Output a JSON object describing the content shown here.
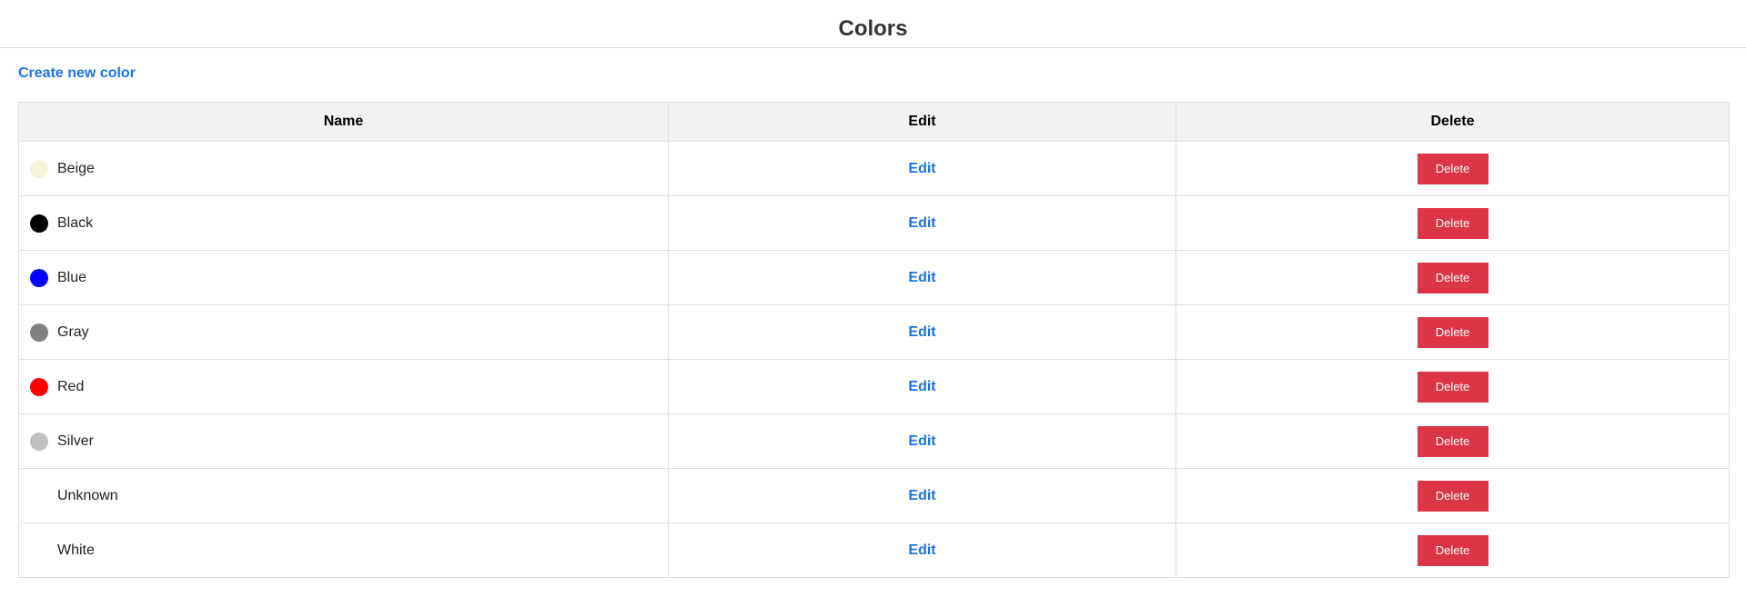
{
  "page": {
    "title": "Colors",
    "create_link": "Create new color"
  },
  "table": {
    "headers": [
      "Name",
      "Edit",
      "Delete"
    ],
    "rows": [
      {
        "name": "Beige",
        "swatch": "#f5f5dc",
        "edit": "Edit",
        "delete": "Delete"
      },
      {
        "name": "Black",
        "swatch": "#000000",
        "edit": "Edit",
        "delete": "Delete"
      },
      {
        "name": "Blue",
        "swatch": "#0000ff",
        "edit": "Edit",
        "delete": "Delete"
      },
      {
        "name": "Gray",
        "swatch": "#808080",
        "edit": "Edit",
        "delete": "Delete"
      },
      {
        "name": "Red",
        "swatch": "#ff0000",
        "edit": "Edit",
        "delete": "Delete"
      },
      {
        "name": "Silver",
        "swatch": "#c0c0c0",
        "edit": "Edit",
        "delete": "Delete"
      },
      {
        "name": "Unknown",
        "swatch": "",
        "edit": "Edit",
        "delete": "Delete"
      },
      {
        "name": "White",
        "swatch": "#ffffff",
        "edit": "Edit",
        "delete": "Delete"
      }
    ]
  },
  "colors": {
    "link": "#1a73e8",
    "delete_button": "#dc3545",
    "header_bg": "#f2f2f2"
  }
}
